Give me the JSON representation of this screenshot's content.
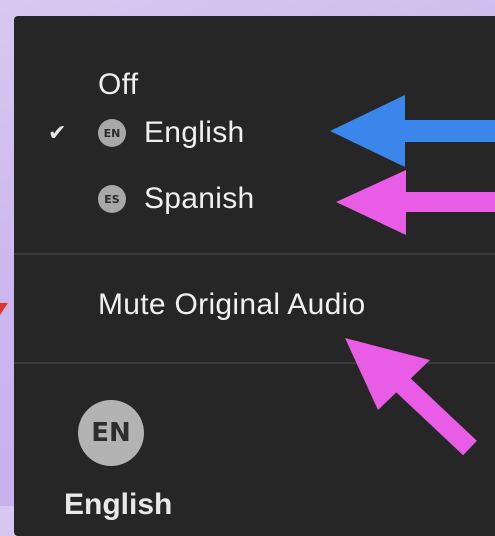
{
  "menu": {
    "items": [
      {
        "label": "Off",
        "checked": false,
        "badge": ""
      },
      {
        "label": "English",
        "checked": true,
        "badge": "EN"
      },
      {
        "label": "Spanish",
        "checked": false,
        "badge": "ES"
      }
    ],
    "mute_label": "Mute Original Audio"
  },
  "footer": {
    "badge": "EN",
    "label": "English"
  },
  "colors": {
    "menu_bg": "#262626",
    "arrow_blue": "#3a86ea",
    "arrow_pink": "#e85ce6",
    "page_bg": "#cbb6ee"
  },
  "icons": {
    "check": "check-icon",
    "english": "language-badge-icon",
    "spanish": "language-badge-icon"
  }
}
